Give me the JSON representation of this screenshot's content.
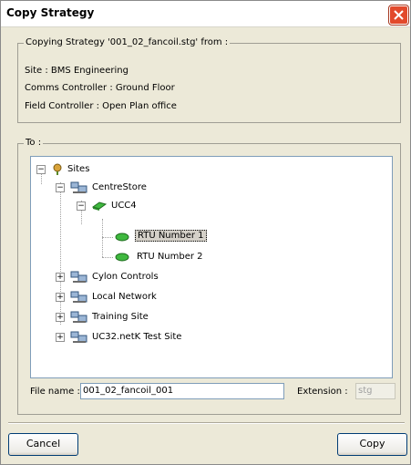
{
  "window": {
    "title": "Copy Strategy"
  },
  "source": {
    "legend": "Copying Strategy '001_02_fancoil.stg' from :",
    "site": "Site :  BMS Engineering",
    "comms": "Comms Controller :  Ground Floor",
    "field": "Field Controller :  Open Plan office"
  },
  "to": {
    "legend": "To :",
    "tree": {
      "root": "Sites",
      "centrestore": "CentreStore",
      "ucc4": "UCC4",
      "rtu1": "RTU Number 1",
      "rtu2": "RTU Number 2",
      "cylon": "Cylon Controls",
      "local": "Local Network",
      "training": "Training Site",
      "uc32": "UC32.netK Test Site",
      "expanded_symbol": "−",
      "collapsed_symbol": "+"
    },
    "file_name_label": "File name :",
    "file_name_value": "001_02_fancoil_001",
    "extension_label": "Extension :",
    "extension_value": "stg"
  },
  "buttons": {
    "cancel": "Cancel",
    "copy": "Copy"
  },
  "colors": {
    "close": "#e24a2c",
    "tree_border": "#7f9db9",
    "dialog_bg": "#ece9d8"
  }
}
